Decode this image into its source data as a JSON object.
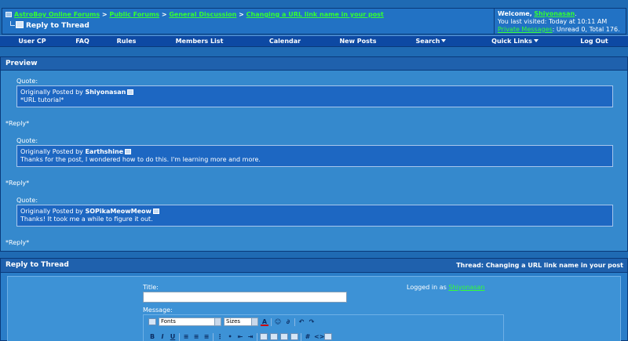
{
  "breadcrumb": {
    "items": [
      "AstroBoy Online Forums",
      "Public Forums",
      "General Discussion",
      "Changing a URL link name in your post"
    ],
    "separator": ">",
    "current": "Reply to Thread"
  },
  "welcome": {
    "greeting": "Welcome,",
    "username": "Shiyonasan",
    "last_visited": "You last visited: Today at 10:11 AM",
    "pm_label": "Private Messages",
    "pm_counts": ": Unread 0, Total 176."
  },
  "menu": [
    {
      "label": "User CP"
    },
    {
      "label": "FAQ"
    },
    {
      "label": "Rules"
    },
    {
      "label": "Members List"
    },
    {
      "label": "Calendar"
    },
    {
      "label": "New Posts"
    },
    {
      "label": "Search"
    },
    {
      "label": "Quick Links"
    },
    {
      "label": "Log Out"
    }
  ],
  "preview": {
    "header": "Preview",
    "quote_label": "Quote:",
    "posted_by_prefix": "Originally Posted by",
    "quotes": [
      {
        "author": "Shiyonasan",
        "text": "*URL tutorial*"
      },
      {
        "author": "Earthshine",
        "text": "Thanks for the post, I wondered how to do this. I'm learning more and more."
      },
      {
        "author": "SOPikaMeowMeow",
        "text": "Thanks! It took me a while to figure it out."
      }
    ],
    "reply_text": "*Reply*"
  },
  "reply": {
    "header": "Reply to Thread",
    "thread_label": "Thread: Changing a URL link name in your post",
    "title_label": "Title:",
    "title_value": "",
    "logged_in_prefix": "Logged in as",
    "logged_in_user": "Shiyonasan",
    "message_label": "Message:",
    "font_select": "Fonts",
    "size_select": "Sizes"
  },
  "colors": {
    "background": "#1f6ab3",
    "link": "#33ff33",
    "menubar": "#0d49a3",
    "panel_header": "#1f61ad",
    "quote_box": "#1d67c2"
  }
}
